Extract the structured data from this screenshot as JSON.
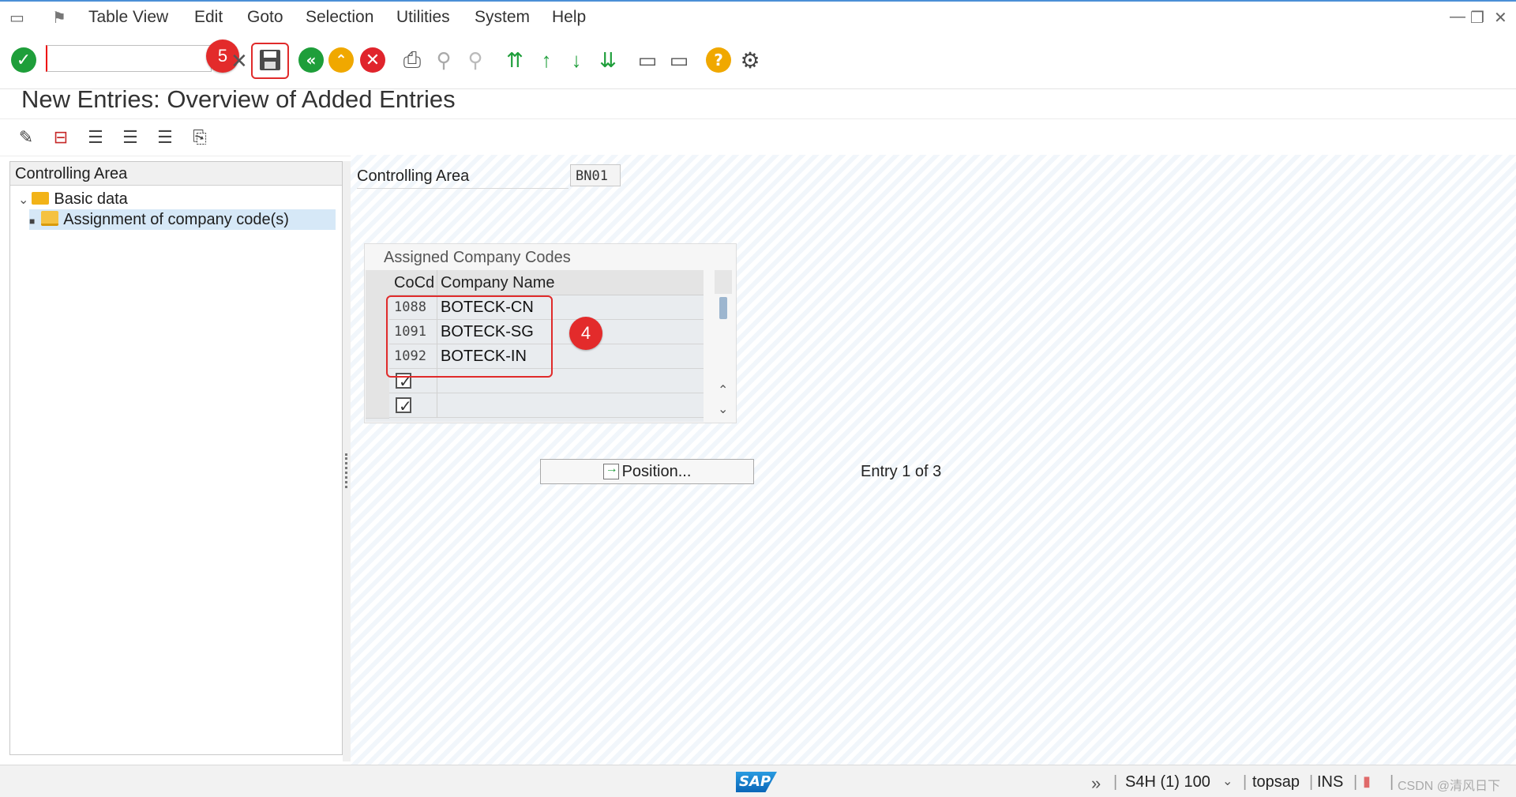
{
  "menu": {
    "items": [
      "Table View",
      "Edit",
      "Goto",
      "Selection",
      "Utilities",
      "System",
      "Help"
    ]
  },
  "toolbar": {
    "command_value": "",
    "badge_save": "5"
  },
  "page": {
    "title": "New Entries: Overview of Added Entries"
  },
  "tree": {
    "header": "Controlling Area",
    "items": [
      {
        "label": "Basic data"
      },
      {
        "label": "Assignment of company code(s)"
      }
    ]
  },
  "content": {
    "ca_label": "Controlling Area",
    "ca_value": "BN01",
    "table": {
      "title": "Assigned Company Codes",
      "columns": [
        "CoCd",
        "Company Name"
      ],
      "rows": [
        {
          "cocd": "1088",
          "name": "BOTECK-CN"
        },
        {
          "cocd": "1091",
          "name": "BOTECK-SG"
        },
        {
          "cocd": "1092",
          "name": "BOTECK-IN"
        }
      ],
      "badge": "4"
    },
    "position_button": "Position...",
    "entry_info": "Entry 1 of 3"
  },
  "status": {
    "system": "S4H (1) 100",
    "user": "topsap",
    "mode": "INS",
    "watermark": "CSDN @清风日下"
  },
  "colors": {
    "accent": "#4b8fd6",
    "highlight": "#e02b2b",
    "selected_row": "#d6e8f7"
  },
  "icons": {
    "toolbar": [
      "enter-icon",
      "save-icon",
      "back-icon",
      "exit-icon",
      "cancel-icon",
      "print-icon",
      "find-icon",
      "find-next-icon",
      "first-page-icon",
      "previous-page-icon",
      "next-page-icon",
      "last-page-icon",
      "new-session-icon",
      "shortcut-icon",
      "help-icon",
      "customize-icon"
    ],
    "secondary": [
      "display-change-icon",
      "delete-icon",
      "select-all-icon",
      "select-block-icon",
      "deselect-all-icon",
      "print-list-icon"
    ]
  }
}
